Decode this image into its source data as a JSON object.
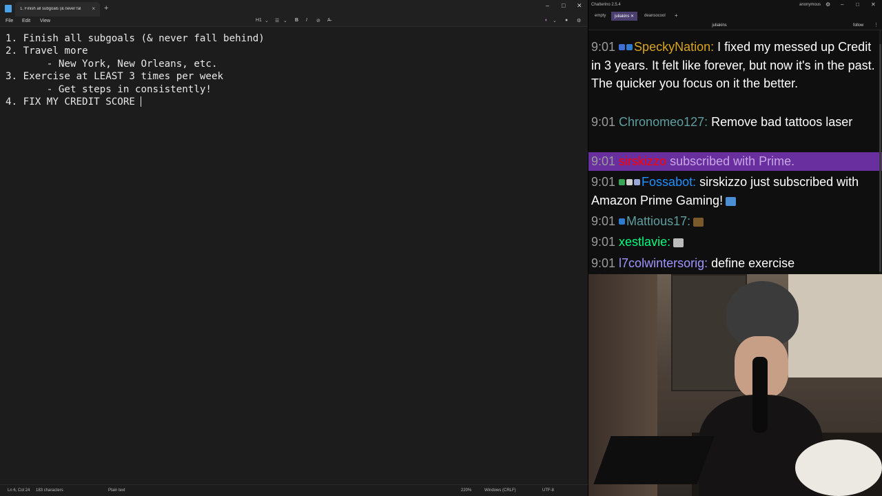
{
  "notepad": {
    "tab_title": "1. Finish all subgoals (& never fal",
    "tab_close": "×",
    "new_tab": "+",
    "window_buttons": [
      "–",
      "□",
      "✕"
    ],
    "menu": [
      "File",
      "Edit",
      "View"
    ],
    "toolbar": {
      "heading": "H1",
      "heading_chevron": "⌄",
      "list": "☰",
      "list_chevron": "⌄",
      "bold": "B",
      "italic": "I",
      "link": "⊘",
      "clear_format": "A̶"
    },
    "toolbar_right": {
      "copilot": "◐",
      "copilot_chevron": "⌄",
      "account": "●",
      "settings": "⚙"
    },
    "lines": [
      "1. Finish all subgoals (& never fall behind)",
      "2. Travel more",
      "       - New York, New Orleans, etc.",
      "3. Exercise at LEAST 3 times per week",
      "       - Get steps in consistently!",
      "4. FIX MY CREDIT SCORE "
    ],
    "status": {
      "position": "Ln 6, Col 24",
      "characters": "183 characters",
      "format": "Plain text",
      "zoom": "220%",
      "line_endings": "Windows (CRLF)",
      "encoding": "UTF-8"
    }
  },
  "chat": {
    "app_title": "Chatterino 2.5.4",
    "user": "anonymous",
    "window_buttons": [
      "⚙",
      "–",
      "□",
      "✕"
    ],
    "tabs": [
      {
        "label": "empty",
        "active": false
      },
      {
        "label": "juliakins ✕",
        "active": true
      },
      {
        "label": "deansocool",
        "active": false
      }
    ],
    "add_tab": "+",
    "channel": "juliakins",
    "follow_label": "follow",
    "menu_icon": "⋮",
    "messages": [
      {
        "time": "9:01",
        "user": "SpeckyNation:",
        "user_color": "#daa520",
        "text": " I fixed my messed up Credit in 3 years. It felt like forever, but now it's in the past. The quicker you focus on it the better.",
        "badges": [
          "#3d6fd6",
          "#2e7bd0"
        ]
      },
      {
        "time": "9:01",
        "user": "Chronomeo127:",
        "user_color": "#5f9ea0",
        "text": " Remove bad tattoos laser",
        "badges": []
      },
      {
        "time": "9:01",
        "user": "sirskizzo",
        "user_color": "#ff0000",
        "text": " subscribed with Prime.",
        "badges": [],
        "sub": true
      },
      {
        "time": "9:01",
        "user": "Fossabot:",
        "user_color": "#1e90ff",
        "text": " sirskizzo just subscribed with Amazon Prime Gaming!",
        "badges": [
          "#3aa655",
          "#cfcfcf",
          "#9aa7d9"
        ],
        "emote_color": "#4a8fd6"
      },
      {
        "time": "9:01",
        "user": "Mattious17:",
        "user_color": "#5f9ea0",
        "text": "",
        "badges": [
          "#2e7bd0"
        ],
        "emote_color": "#7a5a2a"
      },
      {
        "time": "9:01",
        "user": "xestlavie:",
        "user_color": "#00ff7f",
        "text": "",
        "badges": [],
        "emote_color": "#bbbbbb"
      },
      {
        "time": "9:01",
        "user": "l7colwintersorig:",
        "user_color": "#9e95ff",
        "text": " define exercise",
        "badges": []
      }
    ]
  },
  "colors": {
    "notepad_bg": "#1c1c1c",
    "chat_bg": "#0f0f0f",
    "sub_highlight": "#6a2f9e",
    "active_tab": "#4a3f6e"
  }
}
